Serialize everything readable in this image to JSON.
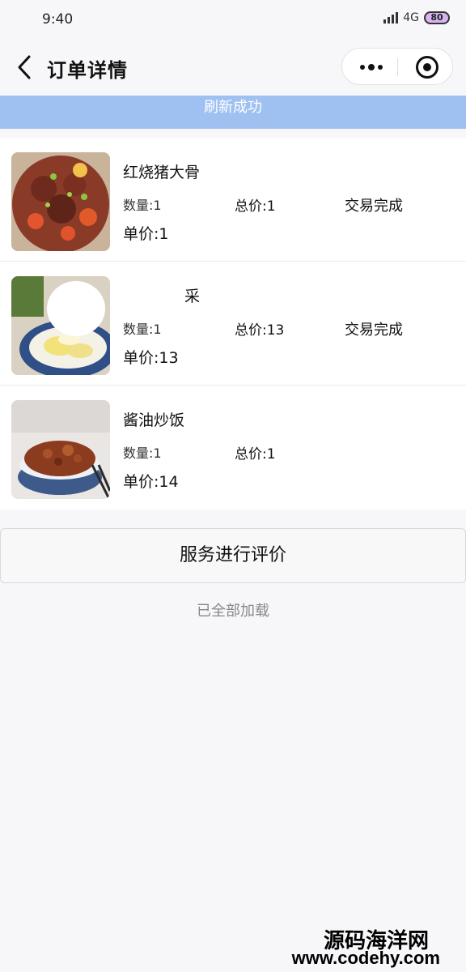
{
  "status_bar": {
    "time": "9:40",
    "network": "4G",
    "battery": "80"
  },
  "nav": {
    "title": "订单详情"
  },
  "banner": {
    "text": "刷新成功"
  },
  "orders": [
    {
      "name": "红烧猪大骨",
      "quantity": "数量:1",
      "total": "总价:1",
      "status": "交易完成",
      "unit_price": "单价:1",
      "image": "braised-pork-bone-photo"
    },
    {
      "name": "采",
      "quantity": "数量:1",
      "total": "总价:13",
      "status": "交易完成",
      "unit_price": "单价:13",
      "image": "vegetable-dish-photo"
    },
    {
      "name": "酱油炒饭",
      "quantity": "数量:1",
      "total": "总价:1",
      "status": "",
      "unit_price": "单价:14",
      "image": "soy-sauce-fried-rice-photo"
    }
  ],
  "review_button": "服务进行评价",
  "loaded_tip": "已全部加载",
  "watermark": {
    "name": "源码海洋网",
    "url": "www.codehy.com"
  },
  "colors": {
    "banner": "#9ec1f2",
    "page_bg": "#f7f7f9"
  }
}
